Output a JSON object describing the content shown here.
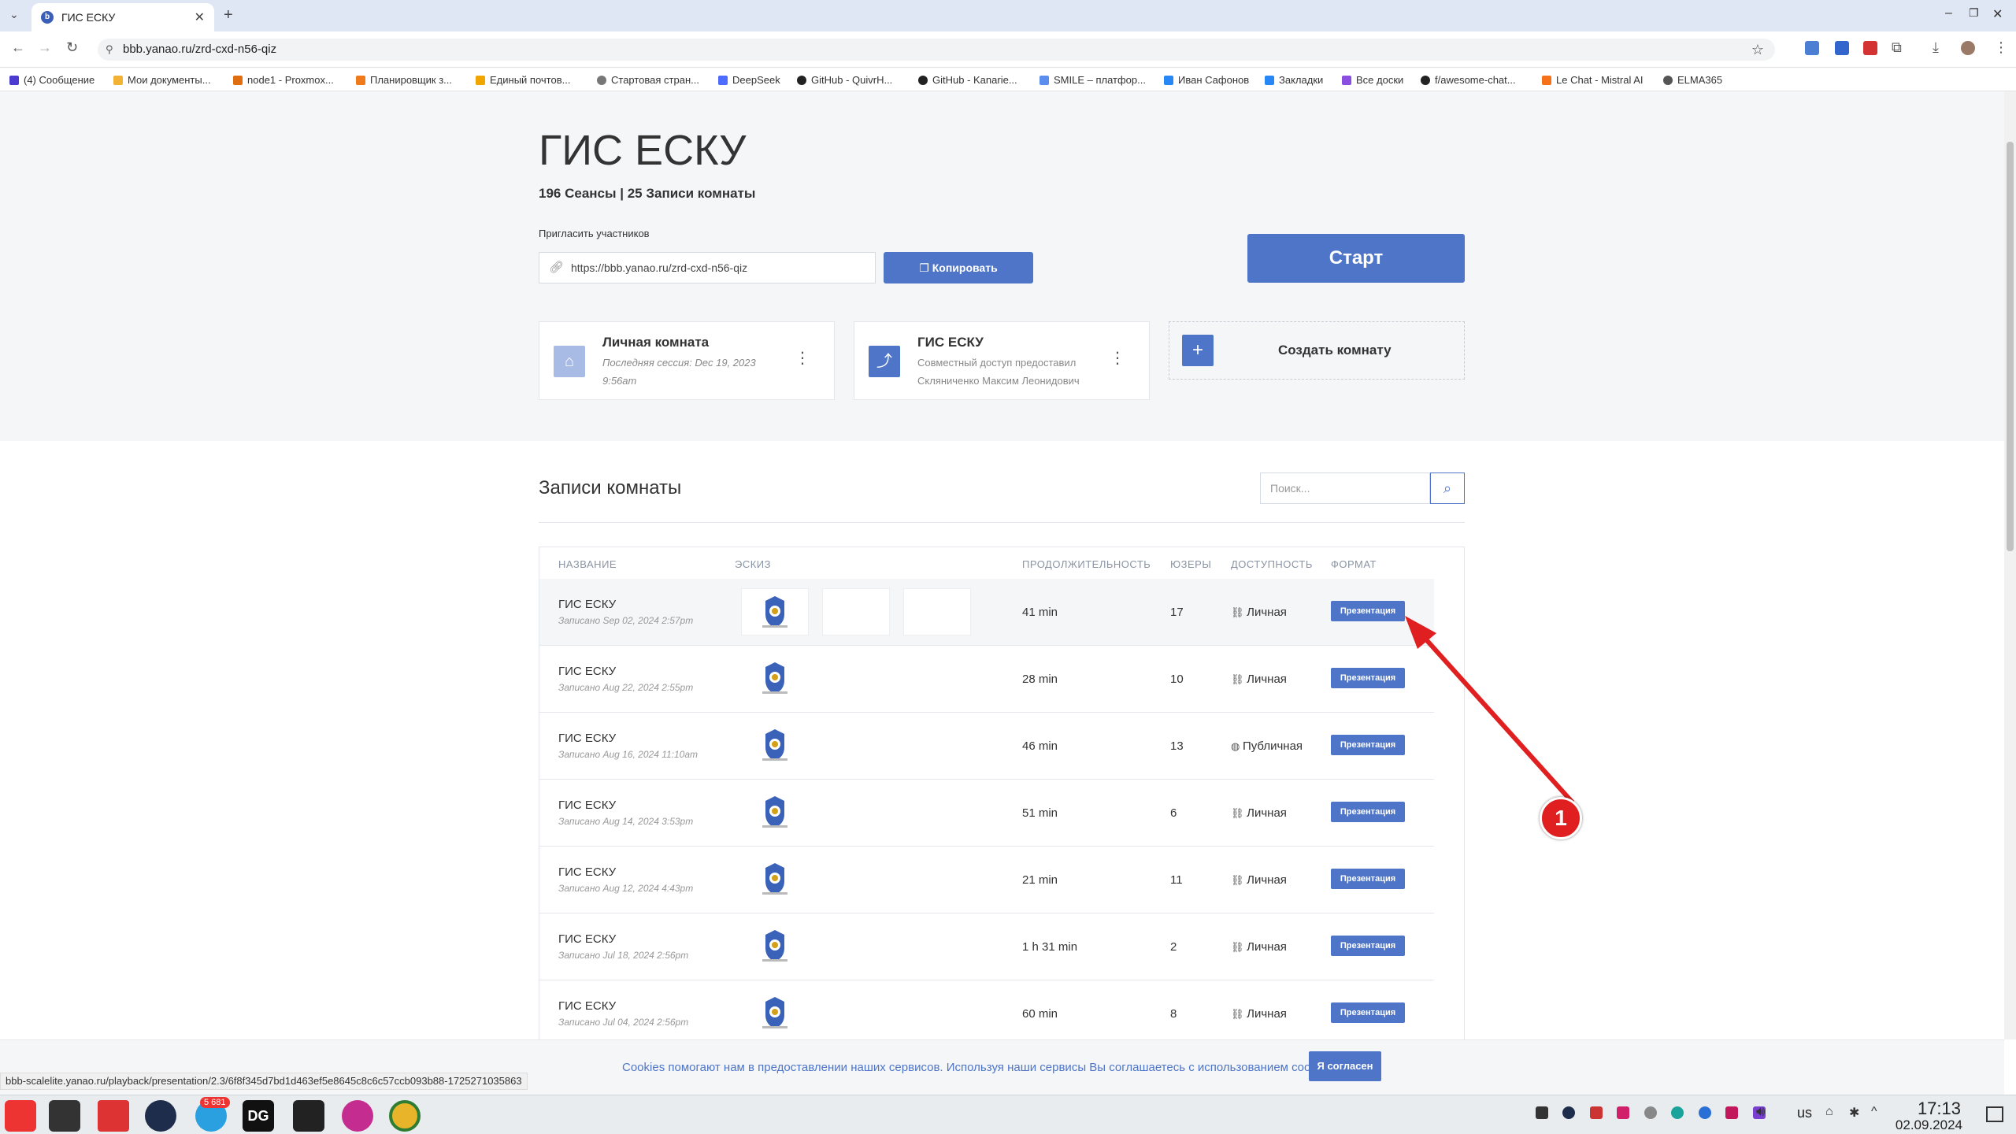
{
  "browser": {
    "tab_title": "ГИС ЕСКУ",
    "url": "bbb.yanao.ru/zrd-cxd-n56-qiz",
    "bookmarks": [
      "(4) Сообщение",
      "Мои документы...",
      "node1 - Proxmox...",
      "Планировщик з...",
      "Единый почтов...",
      "Стартовая стран...",
      "DeepSeek",
      "GitHub - QuivrH...",
      "GitHub - Kanarie...",
      "SMILE – платфор...",
      "Иван Сафонов",
      "Закладки",
      "Все доски",
      "f/awesome-chat...",
      "Le Chat - Mistral AI",
      "ELMA365"
    ],
    "status_url": "bbb-scalelite.yanao.ru/playback/presentation/2.3/6f8f345d7bd1d463ef5e8645c8c6c57ccb093b88-1725271035863"
  },
  "room": {
    "title": "ГИС ЕСКУ",
    "stats": "196 Сеансы | 25 Записи комнаты",
    "invite_label": "Пригласить участников",
    "invite_url": "https://bbb.yanao.ru/zrd-cxd-n56-qiz",
    "copy_label": "Копировать",
    "start_label": "Старт"
  },
  "cards": [
    {
      "title": "Личная комната",
      "subtitle": "Последняя сессия: Dec 19, 2023 9:56am",
      "icon": "home-icon"
    },
    {
      "title": "ГИС ЕСКУ",
      "subtitle": "Совместный доступ предоставил Скляниченко Максим Леонидович",
      "icon": "share-icon"
    }
  ],
  "create_room_label": "Создать комнату",
  "recordings": {
    "title": "Записи комнаты",
    "search_placeholder": "Поиск...",
    "columns": [
      "НАЗВАНИЕ",
      "ЭСКИЗ",
      "ПРОДОЛЖИТЕЛЬНОСТЬ",
      "ЮЗЕРЫ",
      "ДОСТУПНОСТЬ",
      "ФОРМАТ"
    ],
    "rows": [
      {
        "name": "ГИС ЕСКУ",
        "date": "Записано Sep 02, 2024 2:57pm",
        "duration": "41 min",
        "users": "17",
        "access": "Личная",
        "format": "Презентация"
      },
      {
        "name": "ГИС ЕСКУ",
        "date": "Записано Aug 22, 2024 2:55pm",
        "duration": "28 min",
        "users": "10",
        "access": "Личная",
        "format": "Презентация"
      },
      {
        "name": "ГИС ЕСКУ",
        "date": "Записано Aug 16, 2024 11:10am",
        "duration": "46 min",
        "users": "13",
        "access": "Публичная",
        "format": "Презентация"
      },
      {
        "name": "ГИС ЕСКУ",
        "date": "Записано Aug 14, 2024 3:53pm",
        "duration": "51 min",
        "users": "6",
        "access": "Личная",
        "format": "Презентация"
      },
      {
        "name": "ГИС ЕСКУ",
        "date": "Записано Aug 12, 2024 4:43pm",
        "duration": "21 min",
        "users": "11",
        "access": "Личная",
        "format": "Презентация"
      },
      {
        "name": "ГИС ЕСКУ",
        "date": "Записано Jul 18, 2024 2:56pm",
        "duration": "1 h 31 min",
        "users": "2",
        "access": "Личная",
        "format": "Презентация"
      },
      {
        "name": "ГИС ЕСКУ",
        "date": "Записано Jul 04, 2024 2:56pm",
        "duration": "60 min",
        "users": "8",
        "access": "Личная",
        "format": "Презентация"
      }
    ]
  },
  "cookie": {
    "text": "Cookies помогают нам в предоставлении наших сервисов. Используя наши сервисы Вы соглашаетесь с использованием cookies.",
    "accept": "Я согласен"
  },
  "annotation": {
    "label": "1",
    "color": "#e02020"
  },
  "taskbar": {
    "badge": "5 681",
    "lang": "us",
    "time": "17:13",
    "date": "02.09.2024"
  },
  "colors": {
    "accent": "#4f75c8"
  }
}
